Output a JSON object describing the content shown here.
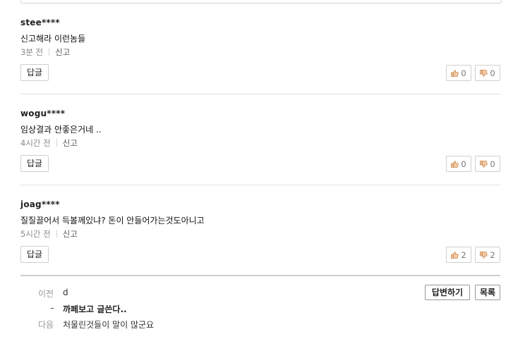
{
  "comments": [
    {
      "author": "stee****",
      "body": "신고해라 이런놈들",
      "time": "3분 전",
      "report_label": "신고",
      "reply_label": "답글",
      "likes": "0",
      "dislikes": "0"
    },
    {
      "author": "wogu****",
      "body": "임상결과 안좋은거네 ..",
      "time": "4시간 전",
      "report_label": "신고",
      "reply_label": "답글",
      "likes": "0",
      "dislikes": "0"
    },
    {
      "author": "joag****",
      "body": "질질끌어서 득볼께있냐? 돈이 안들어가는것도아니고",
      "time": "5시간 전",
      "report_label": "신고",
      "reply_label": "답글",
      "likes": "2",
      "dislikes": "2"
    }
  ],
  "post_nav": {
    "prev_label": "이전",
    "prev_title": "d",
    "current_marker": "–",
    "current_title": "까페보고 글쓴다..",
    "next_label": "다음",
    "next_title": "처물린것들이 말이 많군요",
    "answer_button": "답변하기",
    "list_button": "목록"
  },
  "icons": {
    "like": "thumbs-up-icon",
    "dislike": "thumbs-down-icon"
  },
  "colors": {
    "thumb_fill": "#f4c9a3",
    "thumb_stroke": "#c98a56"
  }
}
